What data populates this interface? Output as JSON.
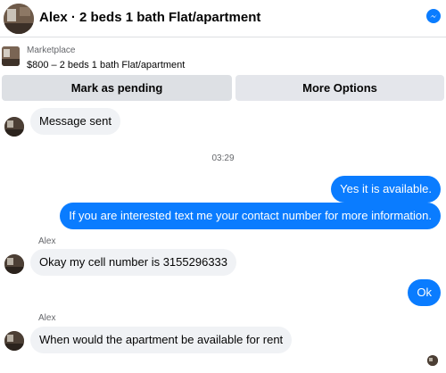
{
  "header": {
    "title": "Alex · 2 beds 1 bath Flat/apartment"
  },
  "listing": {
    "source": "Marketplace",
    "price_title": "$800 – 2 beds 1 bath Flat/apartment"
  },
  "actions": {
    "pending_label": "Mark as pending",
    "more_label": "More Options"
  },
  "messages": [
    {
      "direction": "in",
      "text": "Message sent"
    },
    {
      "direction": "time",
      "text": "03:29"
    },
    {
      "direction": "out",
      "text": "Yes it is available."
    },
    {
      "direction": "out",
      "text": "If you are interested text me your contact number for more information."
    },
    {
      "direction": "in",
      "sender": "Alex",
      "text": "Okay my cell number is 3155296333"
    },
    {
      "direction": "out",
      "text": "Ok"
    },
    {
      "direction": "in",
      "sender": "Alex",
      "text": "When would the apartment be available for rent"
    }
  ],
  "colors": {
    "outgoing_bubble": "#0a7cff",
    "incoming_bubble": "#f0f2f5",
    "button_bg": "#dde0e4"
  }
}
